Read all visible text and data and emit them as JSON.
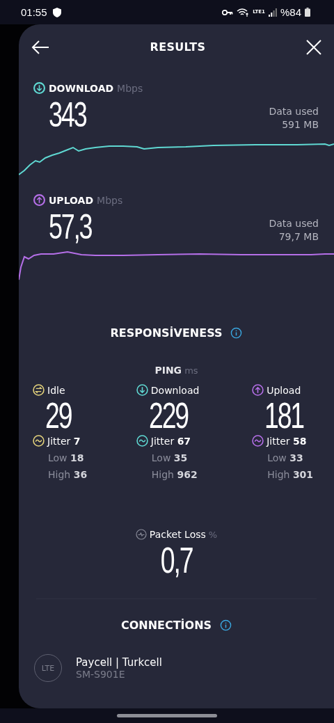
{
  "status_bar": {
    "time": "01:55",
    "network": "LTE1",
    "battery": "%84"
  },
  "header": {
    "title": "RESULTS"
  },
  "speeds": [
    {
      "kind": "download",
      "label": "DOWNLOAD",
      "unit": "Mbps",
      "value": "343",
      "data_label": "Data used",
      "data_value": "591 MB",
      "color": "#5fd8d2"
    },
    {
      "kind": "upload",
      "label": "UPLOAD",
      "unit": "Mbps",
      "value": "57,3",
      "data_label": "Data used",
      "data_value": "79,7 MB",
      "color": "#b56fe8"
    }
  ],
  "responsiveness": {
    "title": "RESPONSİVENESS",
    "ping_label": "PING",
    "ping_unit": "ms",
    "columns": [
      {
        "kind": "idle",
        "label": "Idle",
        "value": "29",
        "jitter_label": "Jitter",
        "jitter": "7",
        "low_label": "Low",
        "low": "18",
        "high_label": "High",
        "high": "36",
        "color": "#e3d27c"
      },
      {
        "kind": "download",
        "label": "Download",
        "value": "229",
        "jitter_label": "Jitter",
        "jitter": "67",
        "low_label": "Low",
        "low": "35",
        "high_label": "High",
        "high": "962",
        "color": "#5fd8d2"
      },
      {
        "kind": "upload",
        "label": "Upload",
        "value": "181",
        "jitter_label": "Jitter",
        "jitter": "58",
        "low_label": "Low",
        "low": "33",
        "high_label": "High",
        "high": "301",
        "color": "#b56fe8"
      }
    ]
  },
  "packet_loss": {
    "label": "Packet Loss",
    "unit": "%",
    "value": "0,7"
  },
  "connections": {
    "title": "CONNECTİONS",
    "items": [
      {
        "badge": "LTE",
        "name": "Paycell | Turkcell",
        "device": "SM-S901E"
      }
    ]
  }
}
